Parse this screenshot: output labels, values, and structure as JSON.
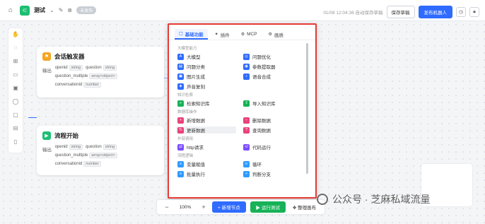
{
  "header": {
    "app_title": "测试",
    "badge": "未发布",
    "status": "01/08 12:04:38 自动保存草稿",
    "save_draft": "保存草稿",
    "publish": "发布机器人"
  },
  "nodes": [
    {
      "title": "会话触发器",
      "color": "#f5a623",
      "out_label": "输出",
      "vars": [
        {
          "name": "openid",
          "type": "string"
        },
        {
          "name": "question",
          "type": "string"
        },
        {
          "name": "question_multiple",
          "type": "array<object>"
        },
        {
          "name": "conversationid",
          "type": "number"
        }
      ]
    },
    {
      "title": "流程开始",
      "color": "#1dbf73",
      "out_label": "输出",
      "vars": [
        {
          "name": "openid",
          "type": "string"
        },
        {
          "name": "question",
          "type": "string"
        },
        {
          "name": "question_multiple",
          "type": "array<object>"
        },
        {
          "name": "conversationid",
          "type": "number"
        }
      ]
    }
  ],
  "popup": {
    "tabs": [
      "基础功能",
      "插件",
      "MCP",
      "画质"
    ],
    "sections": [
      {
        "title": "大模型能力",
        "items": [
          {
            "label": "大模型",
            "icon": "ai-icon",
            "color": "#2f6bff",
            "glyph": "A"
          },
          {
            "label": "问题优化",
            "icon": "optimize-icon",
            "color": "#2f6bff",
            "glyph": "◎"
          },
          {
            "label": "问题分类",
            "icon": "classify-icon",
            "color": "#2f6bff",
            "glyph": "▤"
          },
          {
            "label": "参数提取器",
            "icon": "extract-icon",
            "color": "#2f6bff",
            "glyph": "◉"
          },
          {
            "label": "图片生成",
            "icon": "image-icon",
            "color": "#2f6bff",
            "glyph": "▣"
          },
          {
            "label": "语音合成",
            "icon": "voice-icon",
            "color": "#2f6bff",
            "glyph": "♪"
          },
          {
            "label": "声音复刻",
            "icon": "clone-voice-icon",
            "color": "#2f6bff",
            "glyph": "◈"
          }
        ]
      },
      {
        "title": "知识检索",
        "items": [
          {
            "label": "检索知识库",
            "icon": "search-kb-icon",
            "color": "#16b257",
            "glyph": "⌕"
          },
          {
            "label": "导入知识库",
            "icon": "import-kb-icon",
            "color": "#16b257",
            "glyph": "⇪"
          }
        ]
      },
      {
        "title": "数据库操作",
        "items": [
          {
            "label": "新增数据",
            "icon": "add-data-icon",
            "color": "#e8437a",
            "glyph": "+"
          },
          {
            "label": "删除数据",
            "icon": "delete-data-icon",
            "color": "#e8437a",
            "glyph": "−"
          },
          {
            "label": "更新数据",
            "icon": "update-data-icon",
            "color": "#e8437a",
            "glyph": "↻"
          },
          {
            "label": "查询数据",
            "icon": "query-data-icon",
            "color": "#e8437a",
            "glyph": "?"
          }
        ]
      },
      {
        "title": "外部调用",
        "items": [
          {
            "label": "http请求",
            "icon": "http-icon",
            "color": "#7a4dff",
            "glyph": "⇄"
          },
          {
            "label": "代码运行",
            "icon": "code-icon",
            "color": "#7a4dff",
            "glyph": "</"
          }
        ]
      },
      {
        "title": "流程逻辑",
        "items": [
          {
            "label": "变量赋值",
            "icon": "variable-icon",
            "color": "#2f9bff",
            "glyph": "x"
          },
          {
            "label": "循环",
            "icon": "loop-icon",
            "color": "#2f9bff",
            "glyph": "∞"
          },
          {
            "label": "批量执行",
            "icon": "batch-icon",
            "color": "#2f9bff",
            "glyph": "≡"
          },
          {
            "label": "判断分支",
            "icon": "branch-icon",
            "color": "#2f9bff",
            "glyph": "⑂"
          }
        ]
      }
    ]
  },
  "bottom": {
    "zoom": "100%",
    "new_node": "+ 新增节点",
    "run_test": "▶ 运行测试",
    "arrange": "✥ 整理画布"
  },
  "watermark": "公众号 · 芝麻私域流量"
}
